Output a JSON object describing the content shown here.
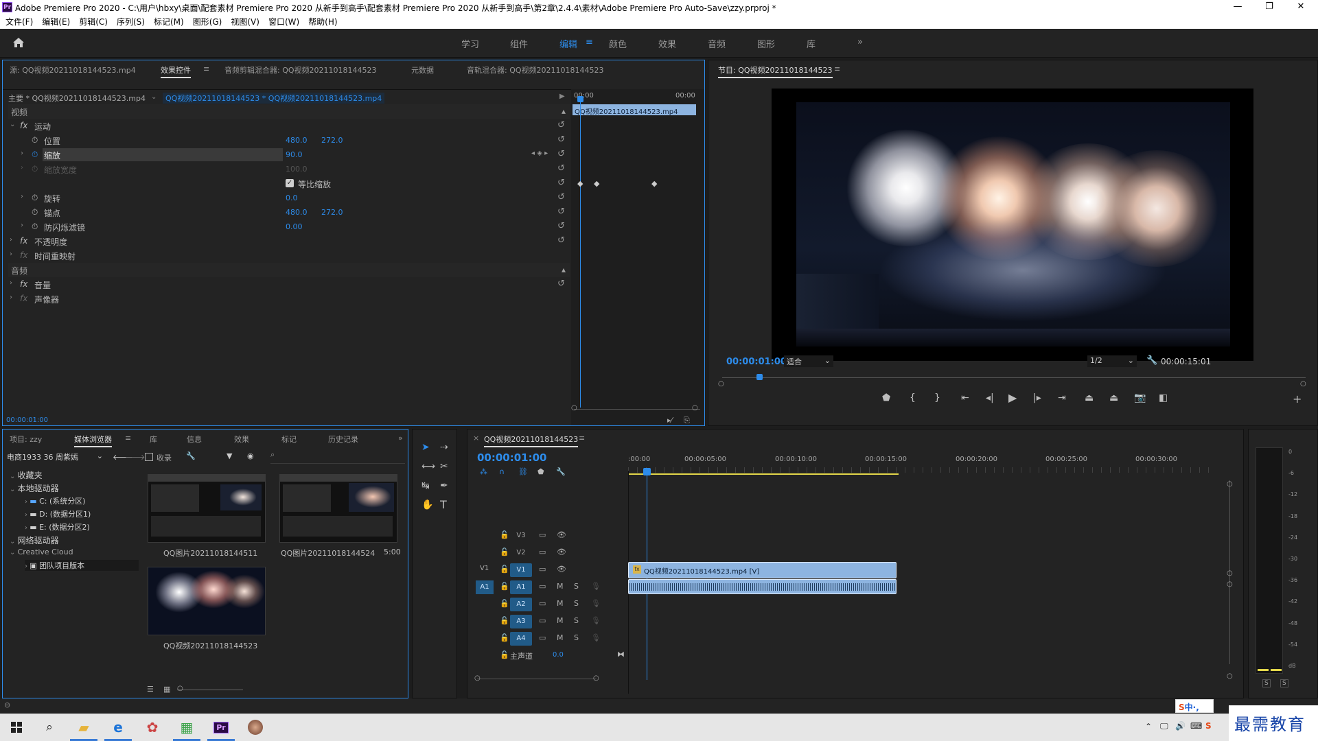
{
  "window": {
    "title": "Adobe Premiere Pro 2020 - C:\\用户\\hbxy\\桌面\\配套素材 Premiere Pro 2020 从新手到高手\\配套素材 Premiere Pro 2020 从新手到高手\\第2章\\2.4.4\\素材\\Adobe Premiere Pro Auto-Save\\zzy.prproj *",
    "minimize": "—",
    "maximize": "❐",
    "close": "✕"
  },
  "menu": [
    "文件(F)",
    "编辑(E)",
    "剪辑(C)",
    "序列(S)",
    "标记(M)",
    "图形(G)",
    "视图(V)",
    "窗口(W)",
    "帮助(H)"
  ],
  "workspaces": [
    "学习",
    "组件",
    "编辑",
    "颜色",
    "效果",
    "音频",
    "图形",
    "库"
  ],
  "workspace_active": "编辑",
  "source_panel": {
    "tabs": [
      "源: QQ视频20211018144523.mp4",
      "效果控件",
      "音频剪辑混合器: QQ视频20211018144523",
      "元数据",
      "音轨混合器: QQ视频20211018144523"
    ],
    "master_label": "主要 * QQ视频20211018144523.mp4",
    "clip_label": "QQ视频20211018144523 * QQ视频20211018144523.mp4",
    "mini_ruler_start": "00:00",
    "mini_ruler_end": "00:00",
    "mini_clip": "QQ视频20211018144523.mp4",
    "section_video": "视频",
    "section_audio": "音频",
    "motion": "运动",
    "position": "位置",
    "position_x": "480.0",
    "position_y": "272.0",
    "scale": "缩放",
    "scale_v": "90.0",
    "scale_width": "缩放宽度",
    "scale_width_v": "100.0",
    "uniform_scale": "等比缩放",
    "rotation": "旋转",
    "rotation_v": "0.0",
    "anchor": "锚点",
    "anchor_x": "480.0",
    "anchor_y": "272.0",
    "antiflicker": "防闪烁滤镜",
    "antiflicker_v": "0.00",
    "opacity": "不透明度",
    "time_remap": "时间重映射",
    "volume": "音量",
    "channel_volume": "声像器",
    "timecode": "00:00:01:00"
  },
  "program": {
    "title": "节目: QQ视频20211018144523",
    "timecode": "00:00:01:00",
    "fit": "适合",
    "quality": "1/2",
    "duration": "00:00:15:01"
  },
  "project_panel": {
    "tabs": [
      "项目: zzy",
      "媒体浏览器",
      "库",
      "信息",
      "效果",
      "标记",
      "历史记录"
    ],
    "ingest_device": "电商1933 36 周紫嫣",
    "ingest": "收录",
    "tree": [
      {
        "label": "收藏夹",
        "indent": 0
      },
      {
        "label": "本地驱动器",
        "indent": 0
      },
      {
        "label": "C: (系统分区)",
        "indent": 2
      },
      {
        "label": "D: (数据分区1)",
        "indent": 2
      },
      {
        "label": "E: (数据分区2)",
        "indent": 2
      },
      {
        "label": "网络驱动器",
        "indent": 0
      },
      {
        "label": "Creative Cloud",
        "indent": 0
      },
      {
        "label": "团队项目版本",
        "indent": 2
      }
    ],
    "files": [
      {
        "name": "QQ图片20211018144511",
        "dur": ""
      },
      {
        "name": "QQ图片20211018144524",
        "dur": "5:00"
      },
      {
        "name": "QQ视频20211018144523",
        "dur": ""
      }
    ]
  },
  "timeline": {
    "tab": "QQ视频20211018144523",
    "timecode": "00:00:01:00",
    "ruler": [
      ":00:00",
      "00:00:05:00",
      "00:00:10:00",
      "00:00:15:00",
      "00:00:20:00",
      "00:00:25:00",
      "00:00:30:00"
    ],
    "video_clip": "QQ视频20211018144523.mp4 [V]",
    "video_tracks": [
      {
        "src": "",
        "name": "V3",
        "on": false
      },
      {
        "src": "",
        "name": "V2",
        "on": false
      },
      {
        "src": "V1",
        "name": "V1",
        "on": true
      }
    ],
    "audio_tracks": [
      {
        "src": "A1",
        "name": "A1"
      },
      {
        "src": "",
        "name": "A2"
      },
      {
        "src": "",
        "name": "A3"
      },
      {
        "src": "",
        "name": "A4"
      }
    ],
    "mute": "M",
    "solo": "S",
    "master": "主声道",
    "master_v": "0.0"
  },
  "meter": {
    "scale": [
      "0",
      "-6",
      "-12",
      "-18",
      "-24",
      "-30",
      "-36",
      "-42",
      "-48",
      "-54",
      "dB"
    ],
    "solo": "S"
  },
  "taskbar": {
    "ime": "中",
    "ime2": "·,",
    "watermark": "最需教育"
  },
  "colors": {
    "accent": "#2d8ceb",
    "clip": "#8db4e0",
    "panel": "#232323"
  }
}
